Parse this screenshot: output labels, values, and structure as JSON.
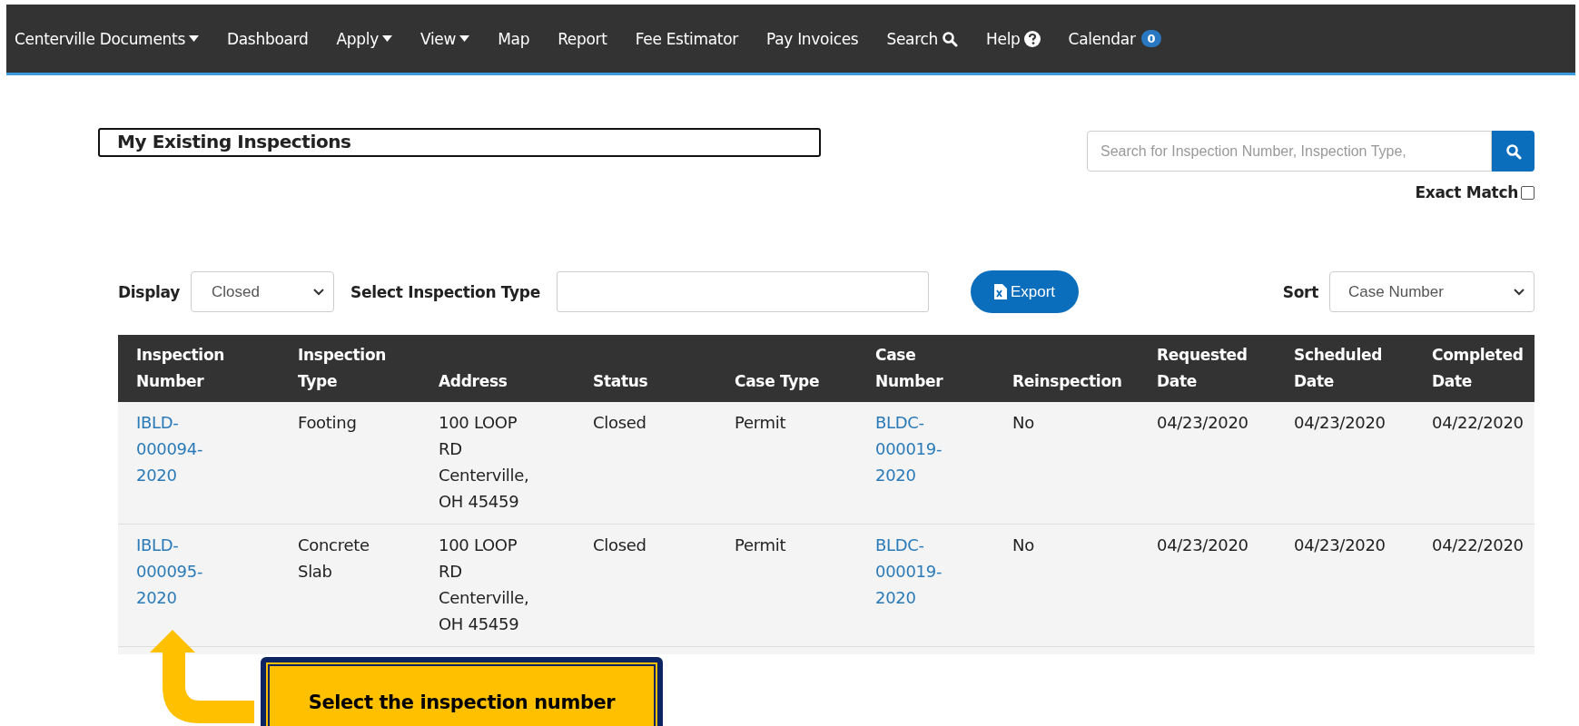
{
  "nav": [
    {
      "label": "Centerville Documents",
      "kind": "dropdown"
    },
    {
      "label": "Dashboard",
      "kind": "plain"
    },
    {
      "label": "Apply",
      "kind": "dropdown"
    },
    {
      "label": "View",
      "kind": "dropdown"
    },
    {
      "label": "Map",
      "kind": "plain"
    },
    {
      "label": "Report",
      "kind": "plain"
    },
    {
      "label": "Fee Estimator",
      "kind": "plain"
    },
    {
      "label": "Pay Invoices",
      "kind": "plain"
    },
    {
      "label": "Search",
      "kind": "search"
    },
    {
      "label": "Help",
      "kind": "help"
    },
    {
      "label": "Calendar",
      "kind": "badge",
      "badge": "0"
    }
  ],
  "title": "My Existing Inspections",
  "search": {
    "placeholder": "Search for Inspection Number, Inspection Type,"
  },
  "exact_match": {
    "label": "Exact Match",
    "checked": false
  },
  "filters": {
    "display_label": "Display",
    "display_value": "Closed",
    "type_label": "Select Inspection Type",
    "export_label": "Export",
    "sort_label": "Sort",
    "sort_value": "Case Number"
  },
  "table": {
    "columns": [
      "Inspection Number",
      "Inspection Type",
      "Address",
      "Status",
      "Case Type",
      "Case Number",
      "Reinspection",
      "Requested Date",
      "Scheduled Date",
      "Completed Date"
    ],
    "rows": [
      [
        "IBLD-000094-2020",
        "Footing",
        "100 LOOP RD Centerville, OH 45459",
        "Closed",
        "Permit",
        "BLDC-000019-2020",
        "No",
        "04/23/2020",
        "04/23/2020",
        "04/22/2020"
      ],
      [
        "IBLD-000095-2020",
        "Concrete Slab",
        "100 LOOP RD Centerville, OH 45459",
        "Closed",
        "Permit",
        "BLDC-000019-2020",
        "No",
        "04/23/2020",
        "04/23/2020",
        "04/22/2020"
      ]
    ]
  },
  "callout": {
    "text": "Select the inspection number"
  }
}
